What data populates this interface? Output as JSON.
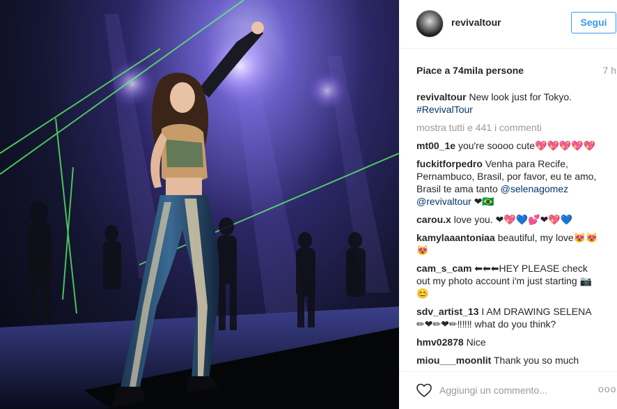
{
  "post": {
    "username": "revivaltour",
    "follow_label": "Segui",
    "likes_text": "Piace a 74mila persone",
    "time_ago": "7 h"
  },
  "caption": {
    "username": "revivaltour",
    "text": "New look just for Tokyo.",
    "hashtag": "#RevivalTour"
  },
  "view_all_comments": "mostra tutti e 441 i commenti",
  "comments": [
    {
      "user": "mt00_1e",
      "text": "you're soooo cute💖💖💖💖💖",
      "mention": "",
      "after": ""
    },
    {
      "user": "fuckitforpedro",
      "text": "Venha para Recife, Pernambuco, Brasil, por favor, eu te amo, Brasil te ama tanto",
      "mention": "@selenagomez @revivaltour",
      "after": "❤🇧🇷"
    },
    {
      "user": "carou.x",
      "text": "love you. ❤💖💙💕❤💖💙",
      "mention": "",
      "after": ""
    },
    {
      "user": "kamylaaantoniaa",
      "text": "beautiful, my love😻😻😻",
      "mention": "",
      "after": ""
    },
    {
      "user": "cam_s_cam",
      "text": "⬅⬅⬅HEY PLEASE check out my photo account i'm just starting 📷😊",
      "mention": "",
      "after": ""
    },
    {
      "user": "sdv_artist_13",
      "text": "I AM DRAWING SELENA ✏❤✏❤✏‼‼‼ what do you think?",
      "mention": "",
      "after": ""
    },
    {
      "user": "hmv02878",
      "text": "Nice",
      "mention": "",
      "after": ""
    },
    {
      "user": "miou___moonlit",
      "text": "Thank you so much",
      "mention": "",
      "after": ""
    }
  ],
  "footer": {
    "like_icon": "heart-outline-icon",
    "comment_placeholder": "Aggiungi un commento...",
    "more_options": "ooo"
  },
  "colors": {
    "link": "#003569",
    "follow": "#3897f0",
    "muted": "#999999"
  }
}
